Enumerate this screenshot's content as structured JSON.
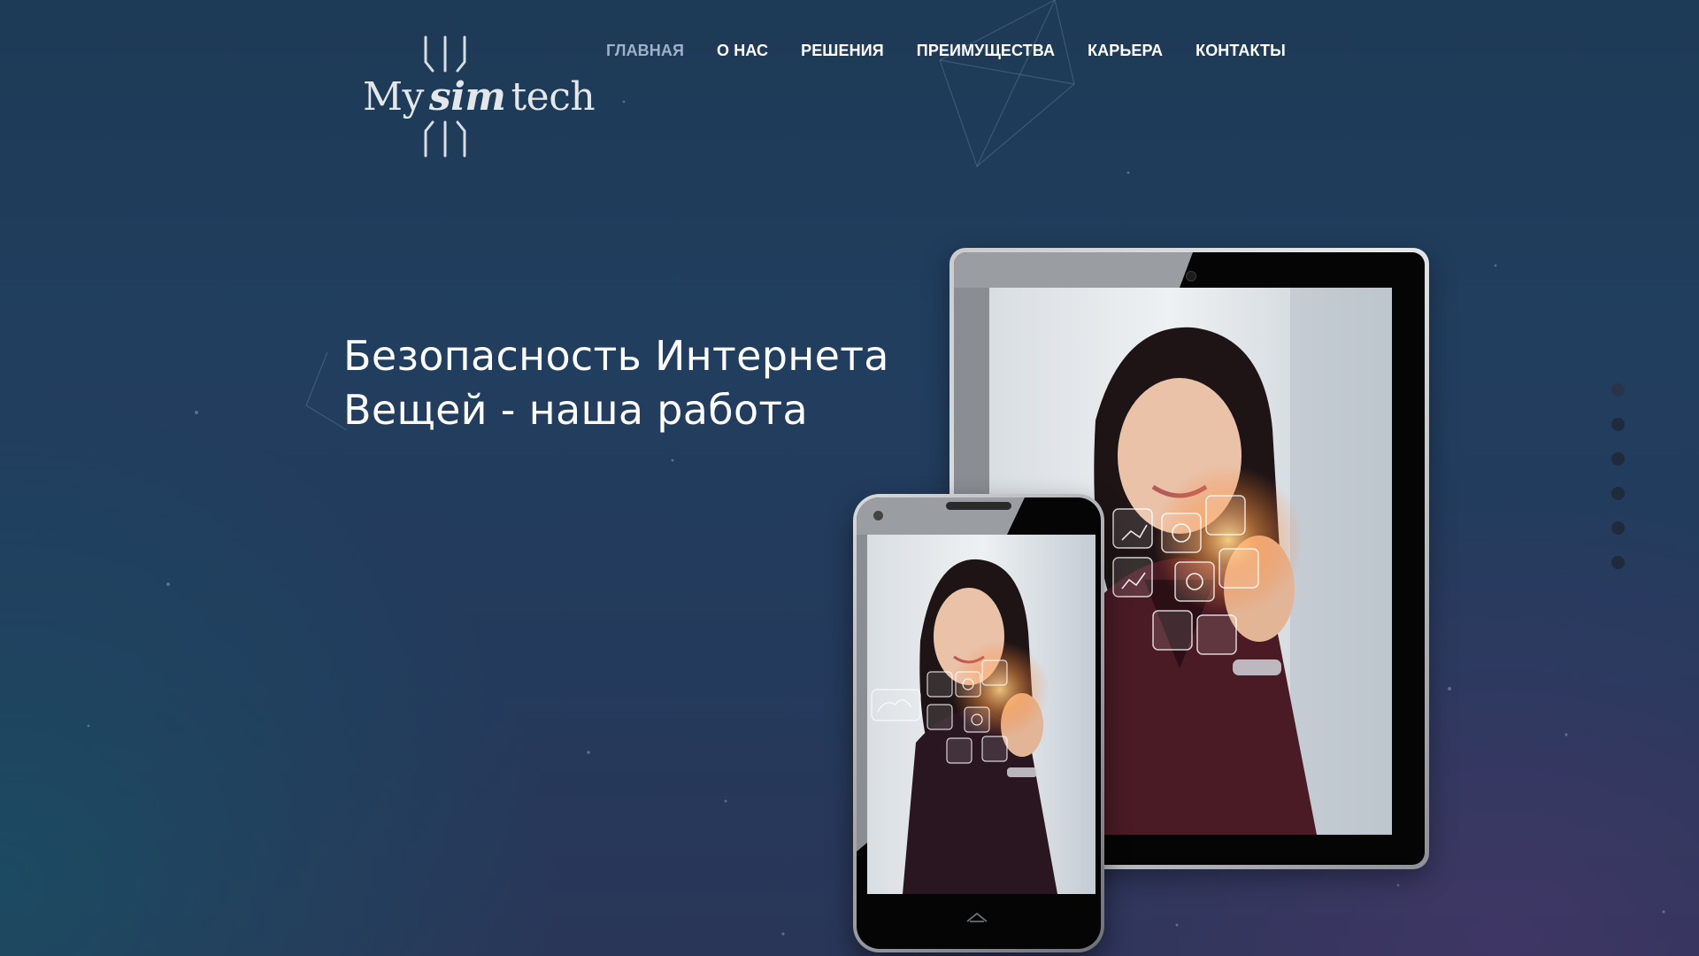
{
  "logo": {
    "word_my": "My",
    "word_sim": "sim",
    "word_tech": "tech"
  },
  "nav": {
    "items": [
      {
        "label": "ГЛАВНАЯ",
        "active": true
      },
      {
        "label": "О НАС",
        "active": false
      },
      {
        "label": "РЕШЕНИЯ",
        "active": false
      },
      {
        "label": "ПРЕИМУЩЕСТВА",
        "active": false
      },
      {
        "label": "КАРЬЕРА",
        "active": false
      },
      {
        "label": "КОНТАКТЫ",
        "active": false
      }
    ]
  },
  "hero": {
    "title_line1": "Безопасность Интернета",
    "title_line2": "Вещей - наша работа"
  },
  "slider": {
    "dot_count": 6,
    "active_index": 0
  },
  "colors": {
    "background": "#213e5f",
    "nav_text": "#ffffff",
    "nav_active": "#9fb1c8",
    "dot": "#1f2a3d"
  },
  "icons": [
    "device-tablet-icon",
    "device-phone-icon",
    "home-button-icon"
  ]
}
